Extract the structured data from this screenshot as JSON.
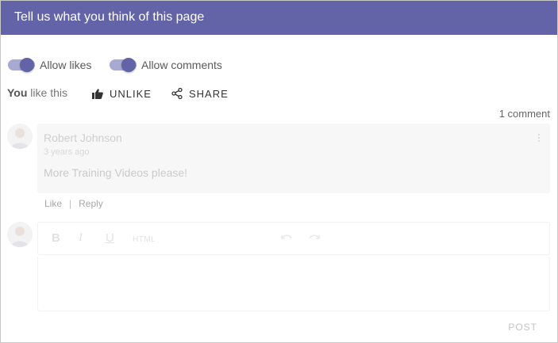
{
  "header": {
    "title": "Tell us what you think of this page"
  },
  "toggles": {
    "allow_likes": {
      "label": "Allow likes",
      "on": true
    },
    "allow_comments": {
      "label": "Allow comments",
      "on": true
    }
  },
  "likes": {
    "you": "You",
    "status_text": "like this",
    "unlike_label": "UNLIKE",
    "share_label": "SHARE"
  },
  "comments": {
    "count_label": "1 comment",
    "items": [
      {
        "author": "Robert Johnson",
        "time": "3 years ago",
        "text": "More Training Videos please!",
        "like_label": "Like",
        "reply_label": "Reply"
      }
    ]
  },
  "editor": {
    "bold": "B",
    "italic": "I",
    "underline": "U",
    "html_label": "HTML",
    "post_label": "POST"
  },
  "colors": {
    "accent": "#6264a7",
    "accent_light": "#a9aad3",
    "header_text": "#ffffff"
  },
  "icons": [
    "thumbs-up-icon",
    "share-icon",
    "more-vertical-icon",
    "undo-icon",
    "redo-icon"
  ]
}
